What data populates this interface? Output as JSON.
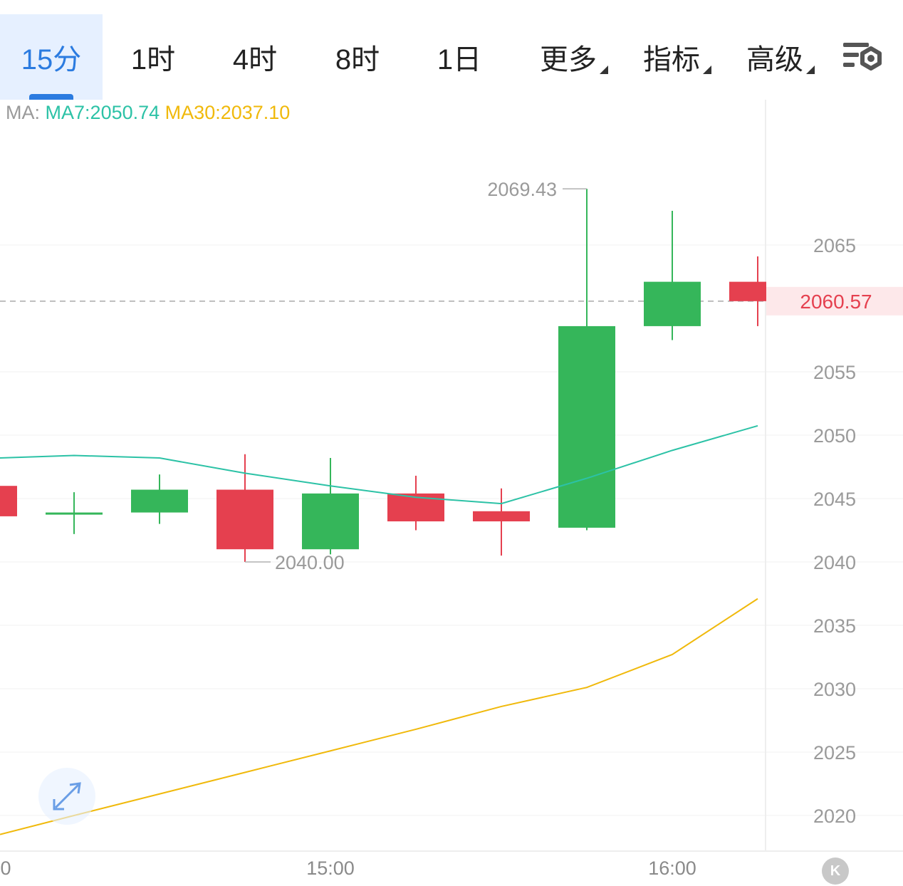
{
  "tabs": [
    {
      "label": "15分",
      "active": true,
      "dropdown": false
    },
    {
      "label": "1时",
      "active": false,
      "dropdown": false
    },
    {
      "label": "4时",
      "active": false,
      "dropdown": false
    },
    {
      "label": "8时",
      "active": false,
      "dropdown": false
    },
    {
      "label": "1日",
      "active": false,
      "dropdown": false
    },
    {
      "label": "更多",
      "active": false,
      "dropdown": true
    },
    {
      "label": "指标",
      "active": false,
      "dropdown": true
    },
    {
      "label": "高级",
      "active": false,
      "dropdown": true
    }
  ],
  "settings_icon": "chart-settings-icon",
  "ma_legend": {
    "label": "MA:",
    "ma7_text": "MA7:2050.74",
    "ma30_text": "MA30:2037.10"
  },
  "colors": {
    "accent": "#2b7be0",
    "up": "#35b65a",
    "down": "#e5404f",
    "ma7": "#2cc2a6",
    "ma30": "#f0b90b",
    "grid": "#f0f0f0",
    "axis_text": "#9a9a9a"
  },
  "chart_data": {
    "type": "candlestick",
    "y_ticks": [
      "2065",
      "2055",
      "2050",
      "2045",
      "2040",
      "2035",
      "2030",
      "2025",
      "2020"
    ],
    "y_tick_values": [
      2065,
      2055,
      2050,
      2045,
      2040,
      2035,
      2030,
      2025,
      2020
    ],
    "ylim": [
      2017,
      2075
    ],
    "x_labels": [
      "0",
      "15:00",
      "16:00"
    ],
    "current_price": 2060.57,
    "current_price_label": "2060.57",
    "high_marker": {
      "value": 2069.43,
      "label": "2069.43"
    },
    "low_marker": {
      "value": 2040.0,
      "label": "2040.00"
    },
    "candles": [
      {
        "open": 2046.0,
        "close": 2043.6,
        "high": 2046.0,
        "low": 2043.6,
        "partial": true
      },
      {
        "open": 2043.9,
        "close": 2043.9,
        "high": 2045.5,
        "low": 2042.2
      },
      {
        "open": 2043.9,
        "close": 2045.7,
        "high": 2046.9,
        "low": 2043.0
      },
      {
        "open": 2045.7,
        "close": 2041.0,
        "high": 2048.5,
        "low": 2040.0
      },
      {
        "open": 2041.0,
        "close": 2045.4,
        "high": 2048.2,
        "low": 2040.6
      },
      {
        "open": 2045.4,
        "close": 2043.2,
        "high": 2046.8,
        "low": 2042.5
      },
      {
        "open": 2044.0,
        "close": 2043.2,
        "high": 2045.8,
        "low": 2040.5
      },
      {
        "open": 2042.7,
        "close": 2058.6,
        "high": 2069.43,
        "low": 2042.5
      },
      {
        "open": 2058.6,
        "close": 2062.1,
        "high": 2067.7,
        "low": 2057.5
      },
      {
        "open": 2062.1,
        "close": 2060.57,
        "high": 2064.1,
        "low": 2058.6
      }
    ],
    "ma7": [
      2048.2,
      2048.4,
      2048.2,
      2047.0,
      2046.0,
      2045.1,
      2044.6,
      2046.6,
      2048.8,
      2050.74
    ],
    "ma30": [
      2018.5,
      2020.0,
      2021.7,
      2023.4,
      2025.1,
      2026.8,
      2028.6,
      2030.1,
      2032.7,
      2037.1
    ]
  }
}
